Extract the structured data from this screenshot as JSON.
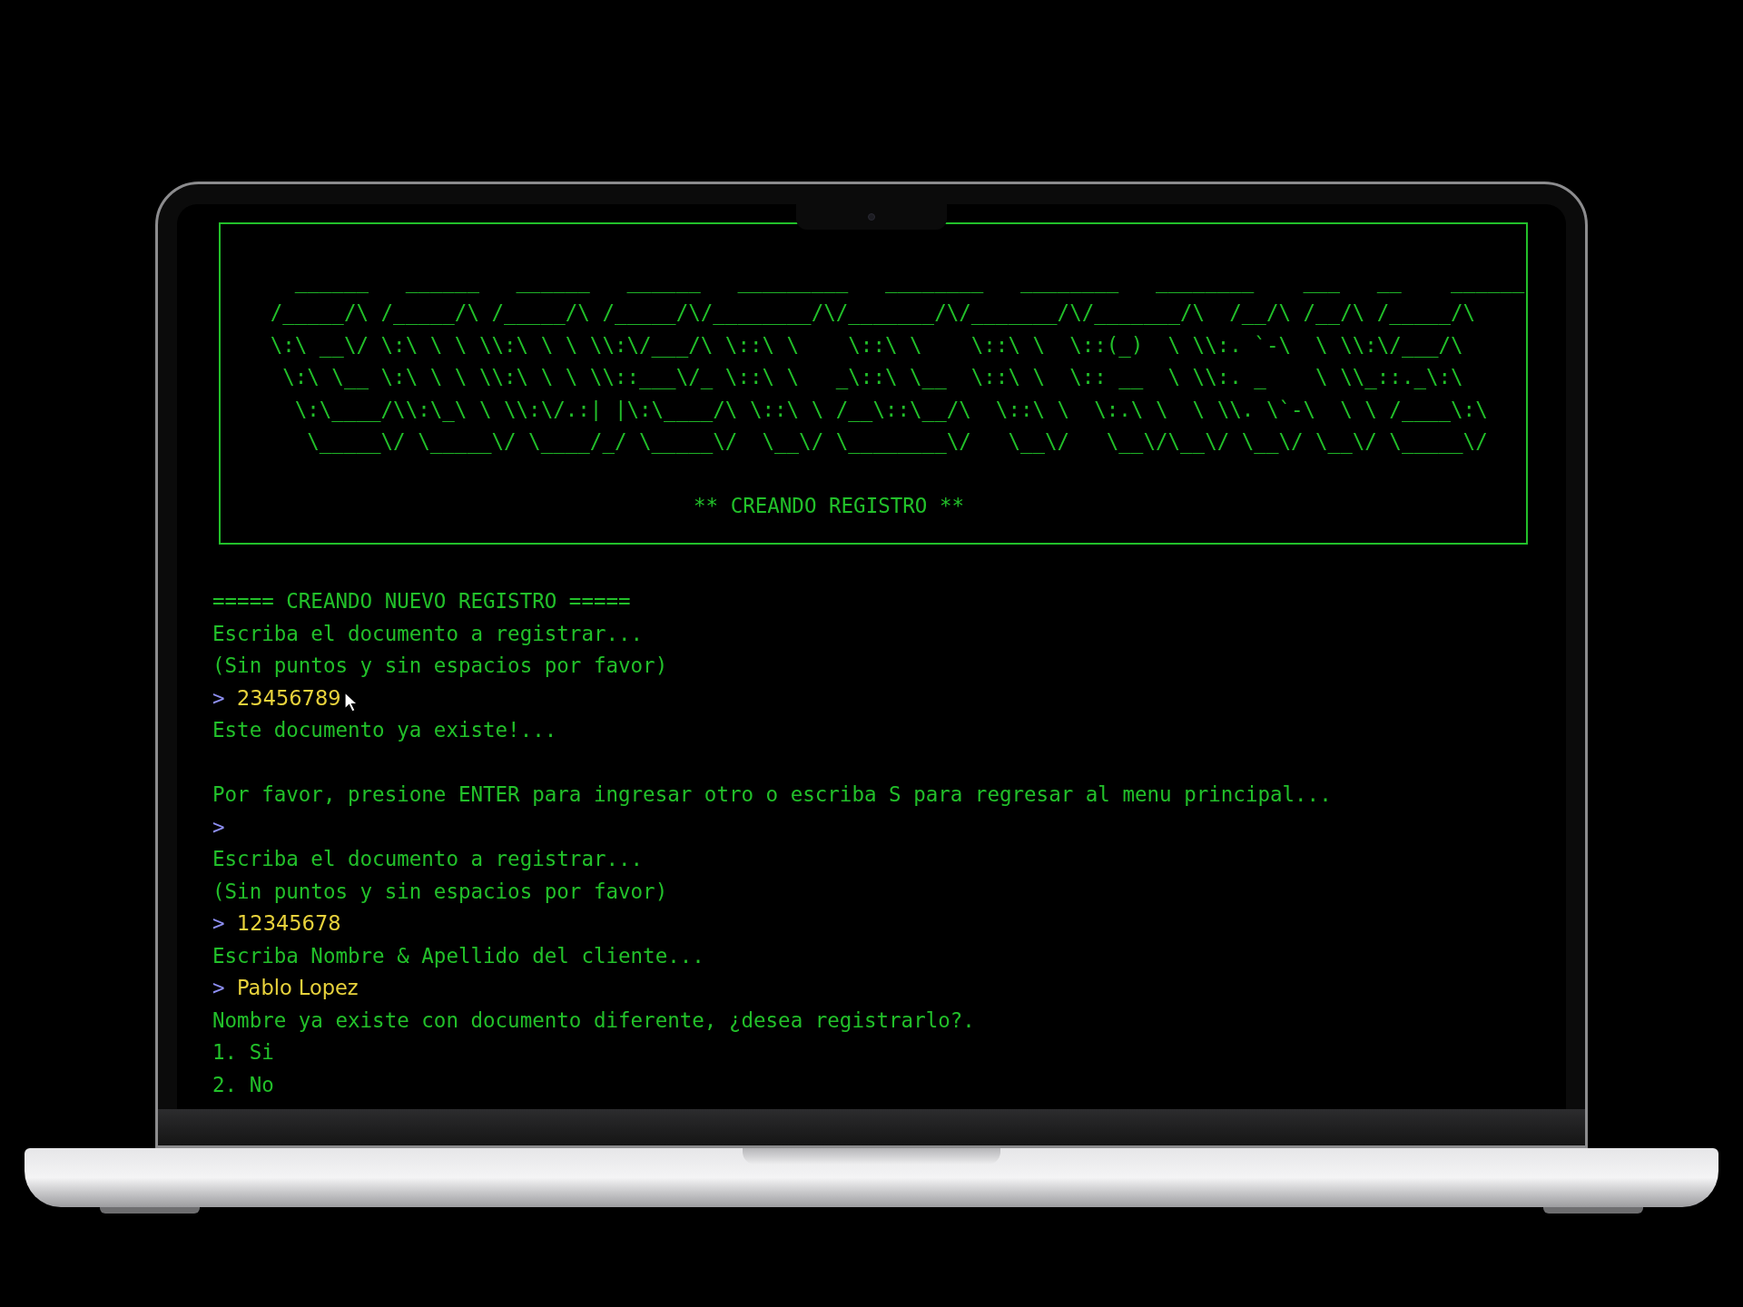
{
  "terminal": {
    "banner": {
      "art": [
        "     ______   ______   ______   ______   _________   ________   ________   ________    ___   __    ______",
        "   /_____/\\ /_____/\\ /_____/\\ /_____/\\/________/\\/_______/\\/_______/\\/_______/\\  /__/\\ /__/\\ /_____/\\",
        "   \\:\\ __\\/ \\:\\ \\ \\ \\\\:\\ \\ \\ \\\\:\\/___/\\ \\::\\ \\    \\::\\ \\    \\::\\ \\  \\::(_)  \\ \\\\:. `-\\  \\ \\\\:\\/___/\\",
        "    \\:\\ \\__ \\:\\ \\ \\ \\\\:\\ \\ \\ \\\\::___\\/_ \\::\\ \\   _\\::\\ \\__  \\::\\ \\  \\:: __  \\ \\\\:. _    \\ \\\\_::._\\:\\",
        "     \\:\\____/\\\\:\\_\\ \\ \\\\:\\/.:| |\\:\\____/\\ \\::\\ \\ /__\\::\\__/\\  \\::\\ \\  \\:.\\ \\  \\ \\\\. \\`-\\  \\ \\ /____\\:\\",
        "      \\_____\\/ \\_____\\/ \\____/_/ \\_____\\/  \\__\\/ \\________\\/   \\__\\/   \\__\\/\\__\\/ \\__\\/ \\__\\/ \\_____\\/"
      ],
      "subtitle": "** CREANDO REGISTRO **"
    },
    "lines": [
      {
        "kind": "output",
        "text": "===== CREANDO NUEVO REGISTRO ====="
      },
      {
        "kind": "output",
        "text": "Escriba el documento a registrar..."
      },
      {
        "kind": "output",
        "text": "(Sin puntos y sin espacios por favor)"
      },
      {
        "kind": "input",
        "prompt": ">",
        "text": "23456789"
      },
      {
        "kind": "output",
        "text": "Este documento ya existe!..."
      },
      {
        "kind": "blank"
      },
      {
        "kind": "output",
        "text": "Por favor, presione ENTER para ingresar otro o escriba S para regresar al menu principal..."
      },
      {
        "kind": "input",
        "prompt": ">"
      },
      {
        "kind": "output",
        "text": "Escriba el documento a registrar..."
      },
      {
        "kind": "output",
        "text": "(Sin puntos y sin espacios por favor)"
      },
      {
        "kind": "input",
        "prompt": ">",
        "text": "12345678"
      },
      {
        "kind": "output",
        "text": "Escriba Nombre & Apellido del cliente..."
      },
      {
        "kind": "input",
        "prompt": ">",
        "text": "Pablo Lopez"
      },
      {
        "kind": "output",
        "text": "Nombre ya existe con documento diferente, ¿desea registrarlo?."
      },
      {
        "kind": "output",
        "text": "1. Si"
      },
      {
        "kind": "output",
        "text": "2. No"
      }
    ]
  }
}
